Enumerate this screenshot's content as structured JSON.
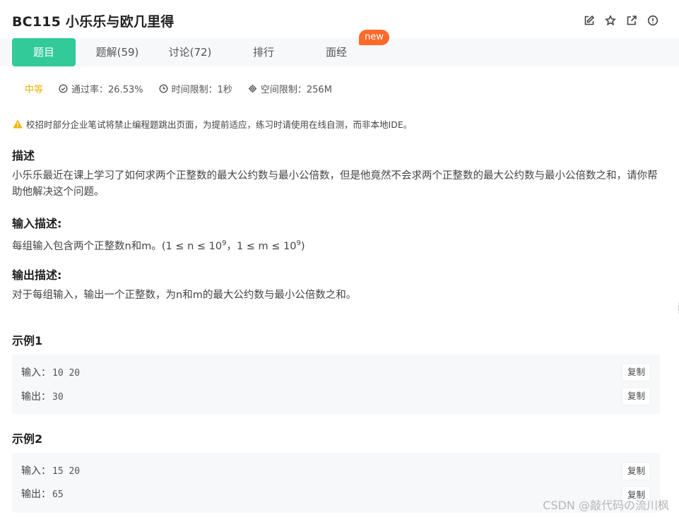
{
  "header": {
    "title": "BC115  小乐乐与欧几里得",
    "icons": [
      "edit-icon",
      "star-icon",
      "external-link-icon",
      "info-icon"
    ]
  },
  "tabs": [
    {
      "label": "题目",
      "active": true
    },
    {
      "label": "题解(59)",
      "active": false
    },
    {
      "label": "讨论(72)",
      "active": false
    },
    {
      "label": "排行",
      "active": false
    },
    {
      "label": "面经",
      "active": false
    }
  ],
  "badge": "new",
  "meta": {
    "difficulty": "中等",
    "pass_rate": "通过率：26.53%",
    "time_limit": "时间限制：1秒",
    "space_limit": "空间限制：256M"
  },
  "notice": "校招时部分企业笔试将禁止编程题跳出页面，为提前适应，练习时请使用在线自测，而非本地IDE。",
  "description": {
    "heading": "描述",
    "text": "小乐乐最近在课上学习了如何求两个正整数的最大公约数与最小公倍数，但是他竟然不会求两个正整数的最大公约数与最小公倍数之和，请你帮助他解决这个问题。"
  },
  "input_desc": {
    "heading": "输入描述:",
    "prefix": "每组输入包含两个正整数n和m。(1 ≤ n ≤ 10",
    "exp1": "9",
    "middle": "，1 ≤ m ≤ 10",
    "exp2": "9",
    "suffix": ")"
  },
  "output_desc": {
    "heading": "输出描述:",
    "text": "对于每组输入，输出一个正整数，为n和m的最大公约数与最小公倍数之和。"
  },
  "examples": [
    {
      "heading": "示例1",
      "input_label": "输入：",
      "input": "10 20",
      "output_label": "输出：",
      "output": "30",
      "copy": "复制"
    },
    {
      "heading": "示例2",
      "input_label": "输入：",
      "input": "15 20",
      "output_label": "输出：",
      "output": "65",
      "copy": "复制"
    }
  ],
  "watermark": "CSDN @敲代码の流川枫",
  "colors": {
    "accent": "#32ca99",
    "badge": "#ff6a2b",
    "difficulty": "#e7b400"
  }
}
